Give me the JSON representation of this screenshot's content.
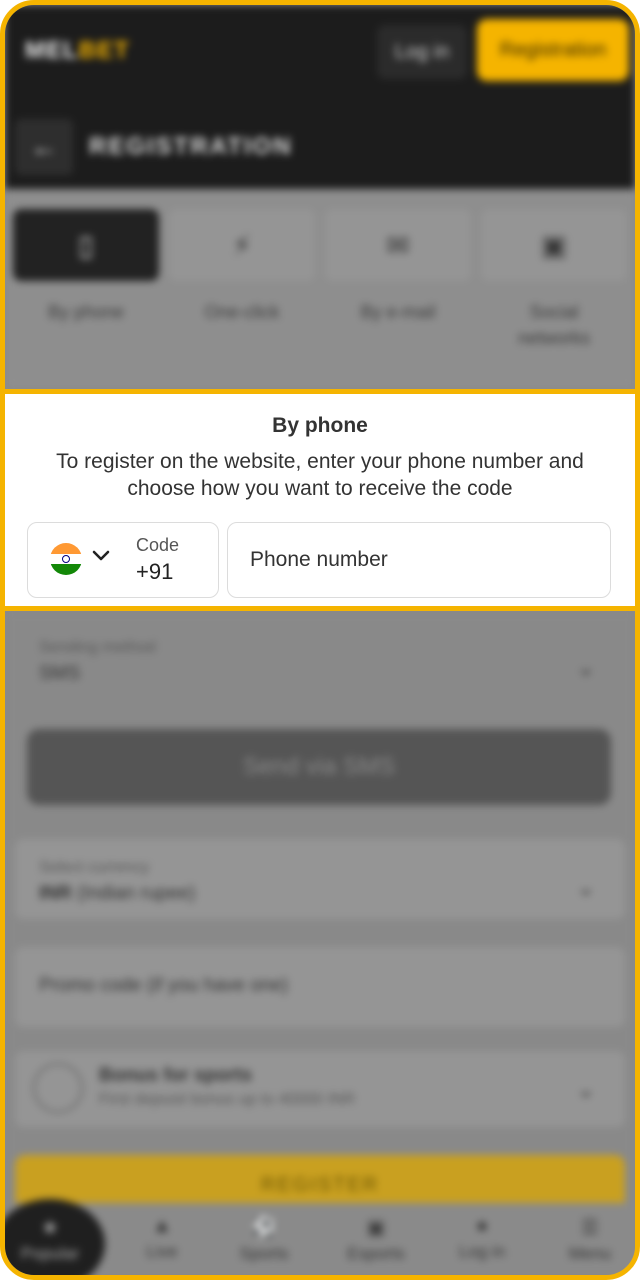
{
  "header": {
    "logo_left": "MEL",
    "logo_right": "BET",
    "login_label": "Log in",
    "registration_label": "Registration"
  },
  "page": {
    "title": "REGISTRATION",
    "back_icon": "arrow-left-icon"
  },
  "tabs": [
    {
      "label": "By phone",
      "icon": "phone-icon",
      "active": true
    },
    {
      "label": "One-click",
      "icon": "lightning-icon",
      "active": false
    },
    {
      "label": "By e-mail",
      "icon": "mail-icon",
      "active": false
    },
    {
      "label": "Social networks",
      "icon": "gamepad-icon",
      "active": false
    }
  ],
  "card": {
    "title": "By phone",
    "description": "To register on the website, enter your phone number and choose how you want to receive the code",
    "code_label": "Code",
    "code_value": "+91",
    "phone_placeholder": "Phone number"
  },
  "form": {
    "sending_method_label": "Sending method",
    "sending_method_value": "SMS",
    "send_button": "Send via SMS",
    "currency_label": "Select currency",
    "currency_code": "INR",
    "currency_name": "(Indian rupee)",
    "promo_placeholder": "Promo code (if you have one)",
    "bonus_title": "Bonus for sports",
    "bonus_desc": "First deposit bonus up to 40000 INR",
    "register_button": "REGISTER"
  },
  "bottom_nav": [
    {
      "label": "Popular",
      "icon": "star-icon",
      "active": true
    },
    {
      "label": "Live",
      "icon": "fire-icon",
      "active": false
    },
    {
      "label": "Sports",
      "icon": "ball-icon",
      "active": false
    },
    {
      "label": "Esports",
      "icon": "gamepad-icon",
      "active": false
    },
    {
      "label": "Log in",
      "icon": "user-icon",
      "active": false
    },
    {
      "label": "Menu",
      "icon": "menu-icon",
      "active": false
    }
  ],
  "colors": {
    "accent": "#f5b400",
    "header_bg": "#1c1c1c",
    "overlay_gray": "#8a8a8a"
  }
}
